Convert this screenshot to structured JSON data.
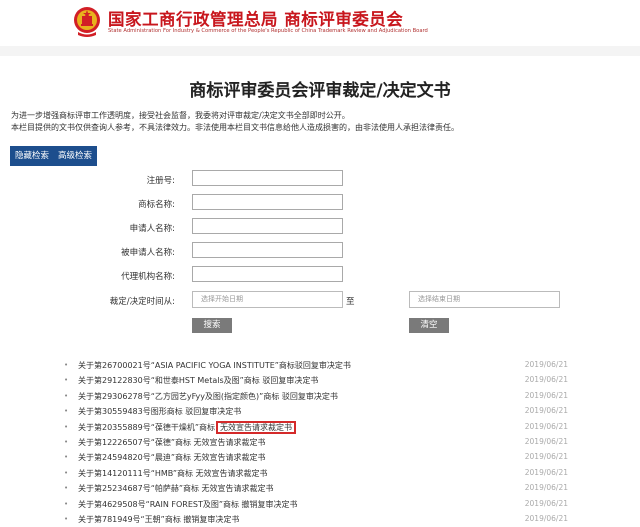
{
  "header": {
    "title": "国家工商行政管理总局  商标评审委员会",
    "subtitle": "State Administration For Industry & Commerce of the People's Republic of China Trademark Review and Adjudication Board"
  },
  "page": {
    "title": "商标评审委员会评审裁定/决定文书",
    "intro_line1": "为进一步增强商标评审工作透明度，接受社会监督，我委将对评审裁定/决定文书全部即时公开。",
    "intro_line2": "本栏目提供的文书仅供查询人参考，不具法律效力。非法使用本栏目文书信息给他人造成损害的，由非法使用人承担法律责任。"
  },
  "buttons": {
    "hide_search": "隐藏检索",
    "advanced_search": "高级检索",
    "search": "搜索",
    "clear": "清空"
  },
  "form": {
    "registration_no_label": "注册号:",
    "trademark_name_label": "商标名称:",
    "applicant_label": "申请人名称:",
    "respondent_label": "被申请人名称:",
    "agency_label": "代理机构名称:",
    "date_label": "裁定/决定时间从:",
    "date_to": "至",
    "start_date_placeholder": "选择开始日期",
    "end_date_placeholder": "选择结束日期"
  },
  "list": [
    {
      "title": "关于第26700021号“ASIA PACIFIC YOGA   INSTITUTE”商标驳回复审决定书",
      "date": "2019/06/21"
    },
    {
      "title": "关于第29122830号“和世泰HST Metals及图”商标  驳回复审决定书",
      "date": "2019/06/21"
    },
    {
      "title": "关于第29306278号“乙方园艺yFyy及图(指定颜色)”商标  驳回复审决定书",
      "date": "2019/06/21"
    },
    {
      "title": "关于第30559483号图形商标  驳回复审决定书",
      "date": "2019/06/21"
    },
    {
      "title": "关于第20355889号“葆德干燥机”商标",
      "highlight": "无效宣告请求裁定书",
      "date": "2019/06/21"
    },
    {
      "title": "关于第12226507号“葆德”商标  无效宣告请求裁定书",
      "date": "2019/06/21"
    },
    {
      "title": "关于第24594820号“晨迪”商标  无效宣告请求裁定书",
      "date": "2019/06/21"
    },
    {
      "title": "关于第14120111号“HMB”商标  无效宣告请求裁定书",
      "date": "2019/06/21"
    },
    {
      "title": "关于第25234687号“帕萨赫”商标  无效宣告请求裁定书",
      "date": "2019/06/21"
    },
    {
      "title": "关于第4629508号“RAIN FOREST及图”商标  撤销复审决定书",
      "date": "2019/06/21"
    },
    {
      "title": "关于第781949号“王朝”商标  撤销复审决定书",
      "date": "2019/06/21"
    }
  ]
}
